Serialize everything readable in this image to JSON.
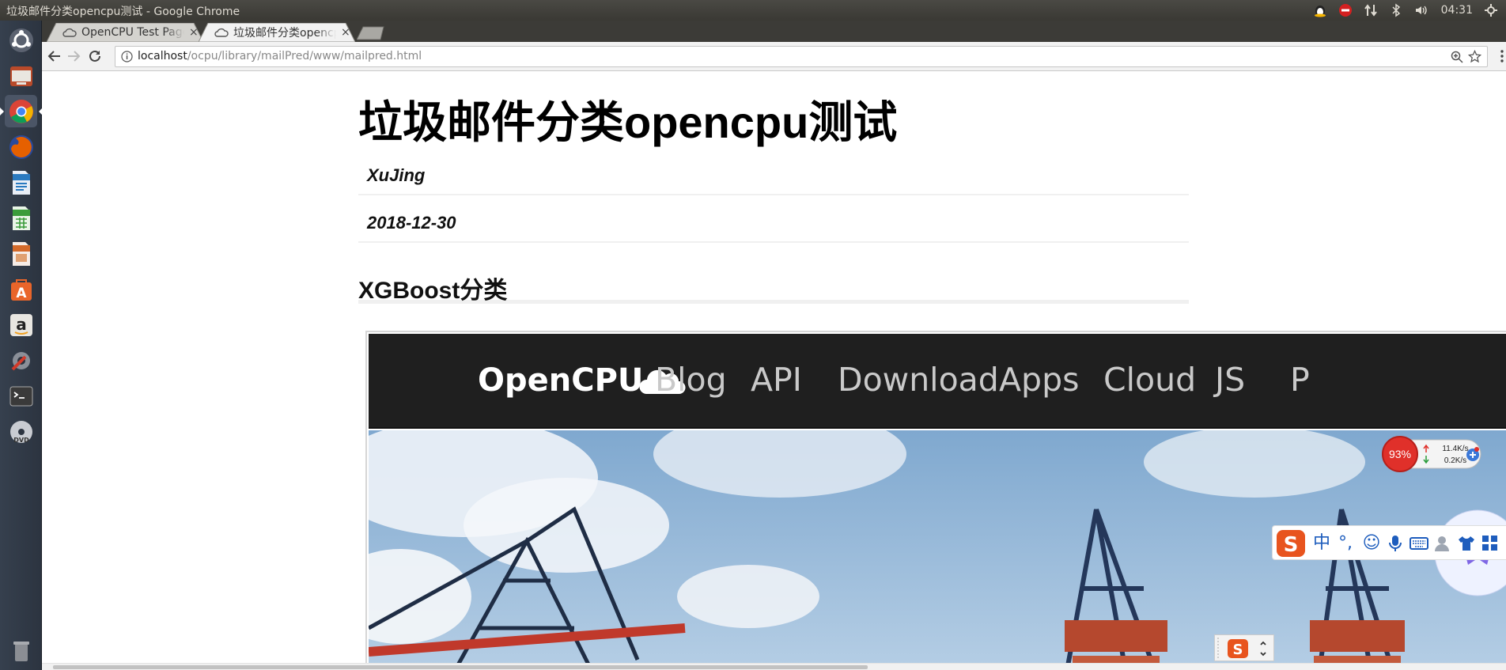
{
  "window": {
    "title": "垃圾邮件分类opencpu测试 - Google Chrome"
  },
  "tray": {
    "clock": "04:31"
  },
  "launcher": {
    "items": [
      "dash-icon",
      "files-icon",
      "chrome-icon",
      "firefox-icon",
      "writer-icon",
      "calc-icon",
      "impress-icon",
      "software-center-icon",
      "amazon-icon",
      "system-settings-icon",
      "terminal-icon",
      "dvd-icon",
      "trash-icon"
    ]
  },
  "tabs": [
    {
      "label": "OpenCPU Test Page",
      "close": "×"
    },
    {
      "label": "垃圾邮件分类opencpu测试",
      "close": "×"
    }
  ],
  "omnibox": {
    "url_host": "localhost",
    "url_path": "/ocpu/library/mailPred/www/mailpred.html"
  },
  "page": {
    "title": "垃圾邮件分类opencpu测试",
    "author": "XuJing",
    "date": "2018-12-30",
    "section": "XGBoost分类"
  },
  "opencpu": {
    "logo_text": "OpenCPU",
    "nav": [
      "Blog",
      "API",
      "Download",
      "Apps",
      "Cloud",
      "JS",
      "P"
    ]
  },
  "net_widget": {
    "percent": "93%",
    "up": "11.4K/s",
    "down": "0.2K/s"
  },
  "ime": {
    "mode": "中",
    "punct": "°,"
  },
  "colors": {
    "accent_red": "#e0302a",
    "ime_blue": "#1e5dbd",
    "ocpu_bg": "#1f1f1f"
  }
}
